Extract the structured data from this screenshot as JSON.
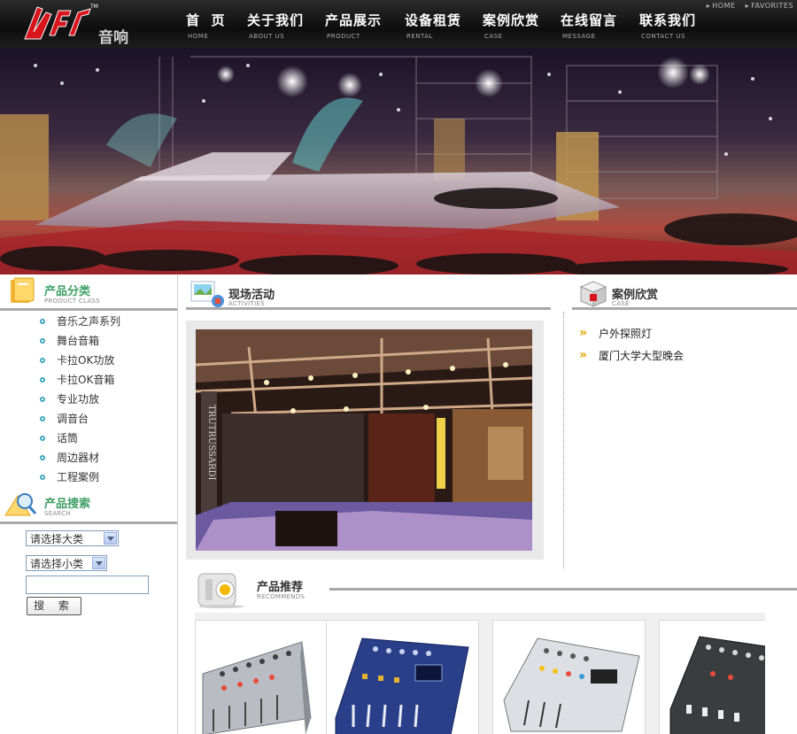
{
  "header": {
    "logo_suffix": "音响",
    "top_links": [
      "HOME",
      "FAVORITES"
    ],
    "nav": [
      {
        "zh": "首  页",
        "en": "HOME"
      },
      {
        "zh": "关于我们",
        "en": "ABOUT US"
      },
      {
        "zh": "产品展示",
        "en": "PRODUCT"
      },
      {
        "zh": "设备租赁",
        "en": "RENTAL"
      },
      {
        "zh": "案例欣赏",
        "en": "CASE"
      },
      {
        "zh": "在线留言",
        "en": "MESSAGE"
      },
      {
        "zh": "联系我们",
        "en": "CONTACT US"
      }
    ]
  },
  "sidebar": {
    "product_class": {
      "title": "产品分类",
      "subtitle": "PRODUCT CLASS",
      "items": [
        "音乐之声系列",
        "舞台音箱",
        "卡拉OK功放",
        "卡拉OK音箱",
        "专业功放",
        "调音台",
        "话筒",
        "周边器材",
        "工程案例"
      ]
    },
    "search": {
      "title": "产品搜索",
      "subtitle": "SEARCH",
      "category_select": "请选择大类",
      "subcategory_select": "请选择小类",
      "keyword_value": "",
      "button_label": "搜 索"
    }
  },
  "activities": {
    "title": "现场活动",
    "subtitle": "ACTIVITIES",
    "photo_sign_text": "TRUTRUSSARDI"
  },
  "case": {
    "title": "案例欣赏",
    "subtitle": "CASE",
    "items": [
      "户外探照灯",
      "厦门大学大型晚会"
    ]
  },
  "recommends": {
    "title": "产品推荐",
    "subtitle": "RECOMMENDS"
  },
  "colors": {
    "section_title_green": "#3f9f65",
    "rule_gray": "#a8a8a8",
    "header_bg": "#1a1a1a",
    "logo_red": "#d8141c"
  }
}
